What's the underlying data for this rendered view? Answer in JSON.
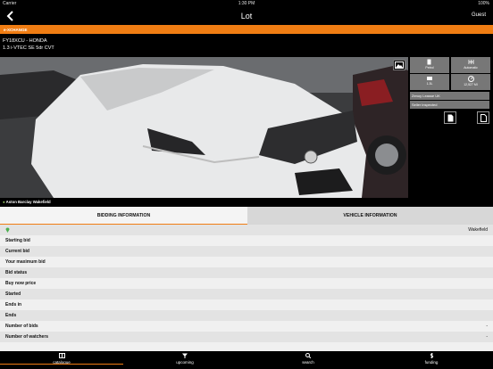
{
  "status_bar": {
    "carrier": "Carrier",
    "time": "1:30 PM",
    "battery": "100%"
  },
  "nav": {
    "title": "Lot",
    "guest_label": "Guest"
  },
  "auction_banner": "e-XCHANGE",
  "vehicle": {
    "registration_make": "FY18XCU - HONDA",
    "description": "1.3 i-VTEC SE 5dr CVT"
  },
  "location_caption": "Aston Barclay Wakefield",
  "side_buttons": [
    {
      "label": "Petrol",
      "icon": "fuel-icon"
    },
    {
      "label": "Automatic",
      "icon": "gearbox-icon"
    },
    {
      "label": "1.3L",
      "icon": "engine-icon"
    },
    {
      "label": "12,527 MI",
      "icon": "odometer-icon"
    }
  ],
  "side_info": [
    "Zenoy Leasse UK",
    "Seller inspected"
  ],
  "tabs": [
    {
      "label": "BIDDING INFORMATION",
      "active": true
    },
    {
      "label": "VEHICLE INFORMATION",
      "active": false
    }
  ],
  "location_row_value": "Wakefield",
  "rows": [
    {
      "label": "Starting bid",
      "value": ""
    },
    {
      "label": "Current bid",
      "value": ""
    },
    {
      "label": "Your maximum bid",
      "value": ""
    },
    {
      "label": "Bid status",
      "value": ""
    },
    {
      "label": "Buy now price",
      "value": ""
    },
    {
      "label": "Started",
      "value": ""
    },
    {
      "label": "Ends in",
      "value": ""
    },
    {
      "label": "Ends",
      "value": ""
    },
    {
      "label": "Number of bids",
      "value": "-"
    },
    {
      "label": "Number of watchers",
      "value": "-"
    }
  ],
  "bottom_tabs": [
    {
      "label": "catalogue",
      "icon": "catalogue-icon"
    },
    {
      "label": "upcoming",
      "icon": "upcoming-icon"
    },
    {
      "label": "search",
      "icon": "search-icon"
    },
    {
      "label": "funding",
      "icon": "funding-icon"
    }
  ],
  "colors": {
    "accent": "#f07d13",
    "chrome": "#000000",
    "panel": "#777777"
  }
}
